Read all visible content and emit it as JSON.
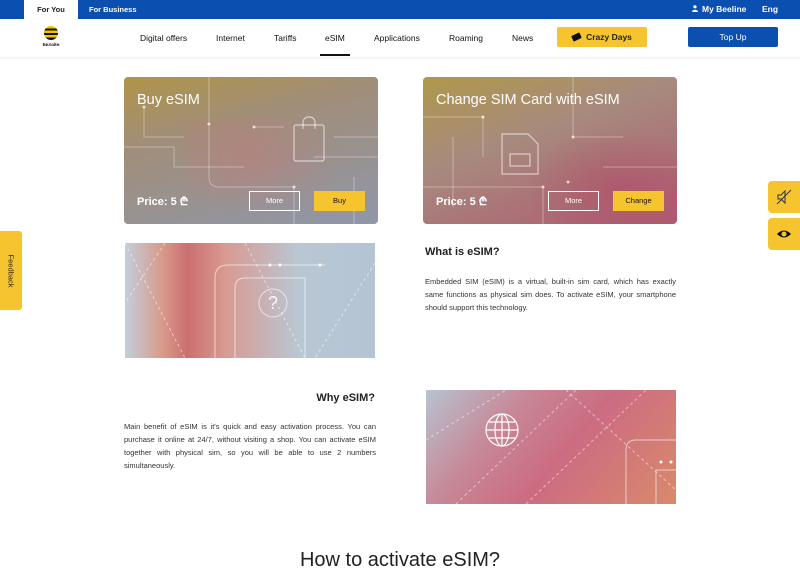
{
  "topbar": {
    "for_you": "For You",
    "for_business": "For Business",
    "my_beeline": "My Beeline",
    "language": "Eng"
  },
  "logo": {
    "text": "Билайн",
    "icon": "beeline-logo-icon"
  },
  "nav": {
    "items": [
      "Digital offers",
      "Internet",
      "Tariffs",
      "eSIM",
      "Applications",
      "Roaming",
      "News"
    ],
    "active": "eSIM",
    "crazy_days": "Crazy Days",
    "top_up": "Top Up"
  },
  "cards": [
    {
      "title": "Buy eSIM",
      "price": "Price: 5 ₾",
      "more_label": "More",
      "action_label": "Buy",
      "icon": "bag-icon"
    },
    {
      "title": "Change SIM Card with eSIM",
      "price": "Price: 5 ₾",
      "more_label": "More",
      "action_label": "Change",
      "icon": "sim-card-icon"
    }
  ],
  "what_is": {
    "heading": "What is eSIM?",
    "text": "Embedded SIM (eSIM) is a virtual, built-in sim card, which has exactly same functions as physical sim does. To activate eSIM, your smartphone should support this technology."
  },
  "why": {
    "heading": "Why eSIM?",
    "text": "Main benefit of eSIM is it's quick and easy activation process. You can purchase it online at 24/7, without visiting a shop. You can activate eSIM together with physical sim, so you will be able to use 2 numbers simultaneously."
  },
  "how": {
    "heading": "How to activate eSIM?"
  },
  "side": {
    "feedback": "Feedback",
    "icons": [
      "sound-off-icon",
      "eye-icon"
    ]
  },
  "colors": {
    "brand_blue": "#0b4fb0",
    "brand_yellow": "#f6c42e"
  }
}
